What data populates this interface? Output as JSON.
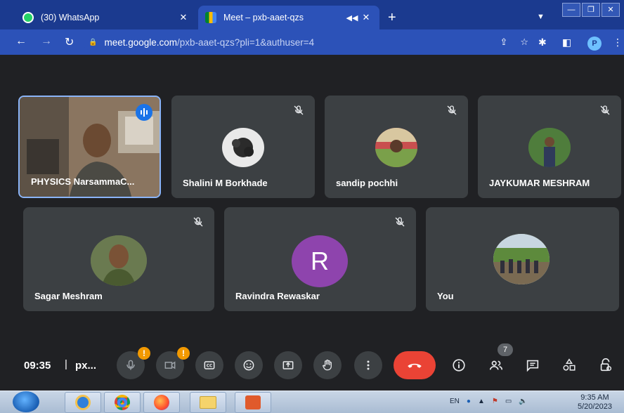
{
  "browser": {
    "tabs": [
      {
        "title": "(30) WhatsApp",
        "favicon": "whatsapp-icon",
        "badge": "30"
      },
      {
        "title": "Meet – pxb-aaet-qzs",
        "favicon": "meet-icon"
      }
    ],
    "url_host": "meet.google.com",
    "url_path": "/pxb-aaet-qzs?pli=1&authuser=4",
    "profile_initial": "P"
  },
  "meet": {
    "participants": [
      {
        "name": "PHYSICS NarsammaC...",
        "speaking": true
      },
      {
        "name": "Shalini M Borkhade",
        "muted": true
      },
      {
        "name": "sandip pochhi",
        "muted": true
      },
      {
        "name": "JAYKUMAR MESHRAM",
        "muted": true
      },
      {
        "name": "Sagar Meshram",
        "muted": true
      },
      {
        "name": "Ravindra Rewaskar",
        "muted": true,
        "initial": "R",
        "avatar_color": "#8e44ad"
      },
      {
        "name": "You"
      }
    ],
    "clock": "09:35",
    "separator": "|",
    "meeting_code": "px...",
    "people_count": "7",
    "mic_warning": "!",
    "cam_warning": "!"
  },
  "taskbar": {
    "language": "EN",
    "time": "9:35 AM",
    "date": "5/20/2023"
  },
  "colors": {
    "chrome_tabbar": "#1b3a8f",
    "chrome_active": "#2c52b8",
    "meet_bg": "#202124",
    "tile_bg": "#3c4043",
    "end_call": "#ea4335",
    "warning": "#f29900",
    "speaking": "#1a73e8"
  }
}
